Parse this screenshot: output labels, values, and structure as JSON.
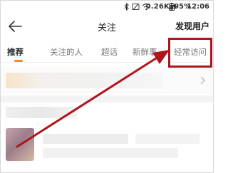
{
  "status_bar": {
    "network_speed": "0.26K/s",
    "battery": "95%",
    "time": "12:06",
    "icons": [
      "bluetooth-icon",
      "mute-icon",
      "wifi-icon",
      "battery-icon"
    ]
  },
  "nav": {
    "title": "关注",
    "right_action": "发现用户",
    "back_icon": "back-arrow-icon"
  },
  "tabs": [
    {
      "label": "推荐",
      "active": true
    },
    {
      "label": "关注的人",
      "active": false
    },
    {
      "label": "超话",
      "active": false
    },
    {
      "label": "新鲜事",
      "active": false
    },
    {
      "label": "经常访问",
      "active": false
    }
  ],
  "colors": {
    "accent": "#f28c28",
    "annotation": "#b0141c"
  }
}
